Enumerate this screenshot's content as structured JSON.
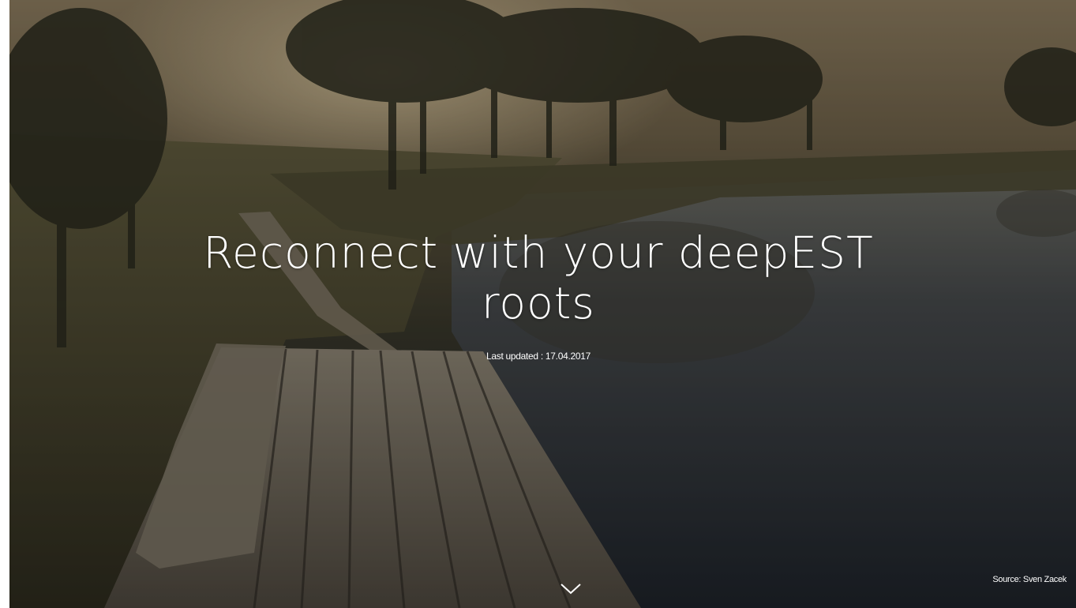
{
  "hero": {
    "title_line1": "Reconnect with your deepEST",
    "title_line2": "roots",
    "last_updated": "Last updated : 17.04.2017",
    "source": "Source: Sven Zacek",
    "scroll_icon": "chevron-down-icon"
  },
  "colors": {
    "text": "#ffffff",
    "sky": "#8a7a5e",
    "water": "#1f2328",
    "boardwalk": "#6b604f"
  }
}
